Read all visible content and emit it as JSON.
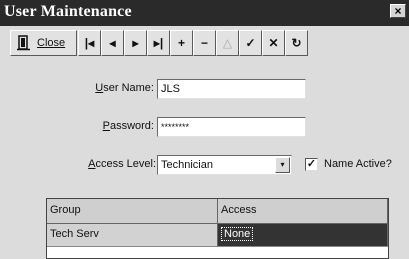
{
  "window": {
    "title": "User Maintenance",
    "close_glyph": "×"
  },
  "toolbar": {
    "close_label": "Close",
    "buttons": [
      {
        "name": "first-record",
        "glyph": "|◂",
        "icon": "first-icon",
        "enabled": true
      },
      {
        "name": "prev-record",
        "glyph": "◂",
        "icon": "prev-icon",
        "enabled": true
      },
      {
        "name": "next-record",
        "glyph": "▸",
        "icon": "next-icon",
        "enabled": true
      },
      {
        "name": "last-record",
        "glyph": "▸|",
        "icon": "last-icon",
        "enabled": true
      },
      {
        "name": "add-record",
        "glyph": "+",
        "icon": "plus-icon",
        "enabled": true
      },
      {
        "name": "delete-record",
        "glyph": "−",
        "icon": "minus-icon",
        "enabled": true
      },
      {
        "name": "edit-record",
        "glyph": "△",
        "icon": "triangle-icon",
        "enabled": false
      },
      {
        "name": "post-record",
        "glyph": "✓",
        "icon": "check-icon",
        "enabled": true
      },
      {
        "name": "cancel-record",
        "glyph": "✕",
        "icon": "x-icon",
        "enabled": true
      },
      {
        "name": "refresh-record",
        "glyph": "↻",
        "icon": "refresh-icon",
        "enabled": true
      }
    ]
  },
  "form": {
    "user_name_label_hot": "U",
    "user_name_label_rest": "ser Name:",
    "user_name_value": "JLS",
    "password_label_hot": "P",
    "password_label_rest": "assword:",
    "password_value": "********",
    "access_level_label_hot": "A",
    "access_level_label_rest": "ccess Level:",
    "access_level_value": "Technician",
    "name_active_label": "Name Active?",
    "name_active_checked": true,
    "checkmark": "✓",
    "dropdown_glyph": "▾"
  },
  "grid": {
    "columns": [
      "Group",
      "Access"
    ],
    "rows": [
      {
        "group": "Tech Serv",
        "access": "None"
      }
    ]
  },
  "colors": {
    "title_bar": "#2a2a2a",
    "window_bg": "#dcdcdc",
    "selected_cell": "#333333"
  }
}
